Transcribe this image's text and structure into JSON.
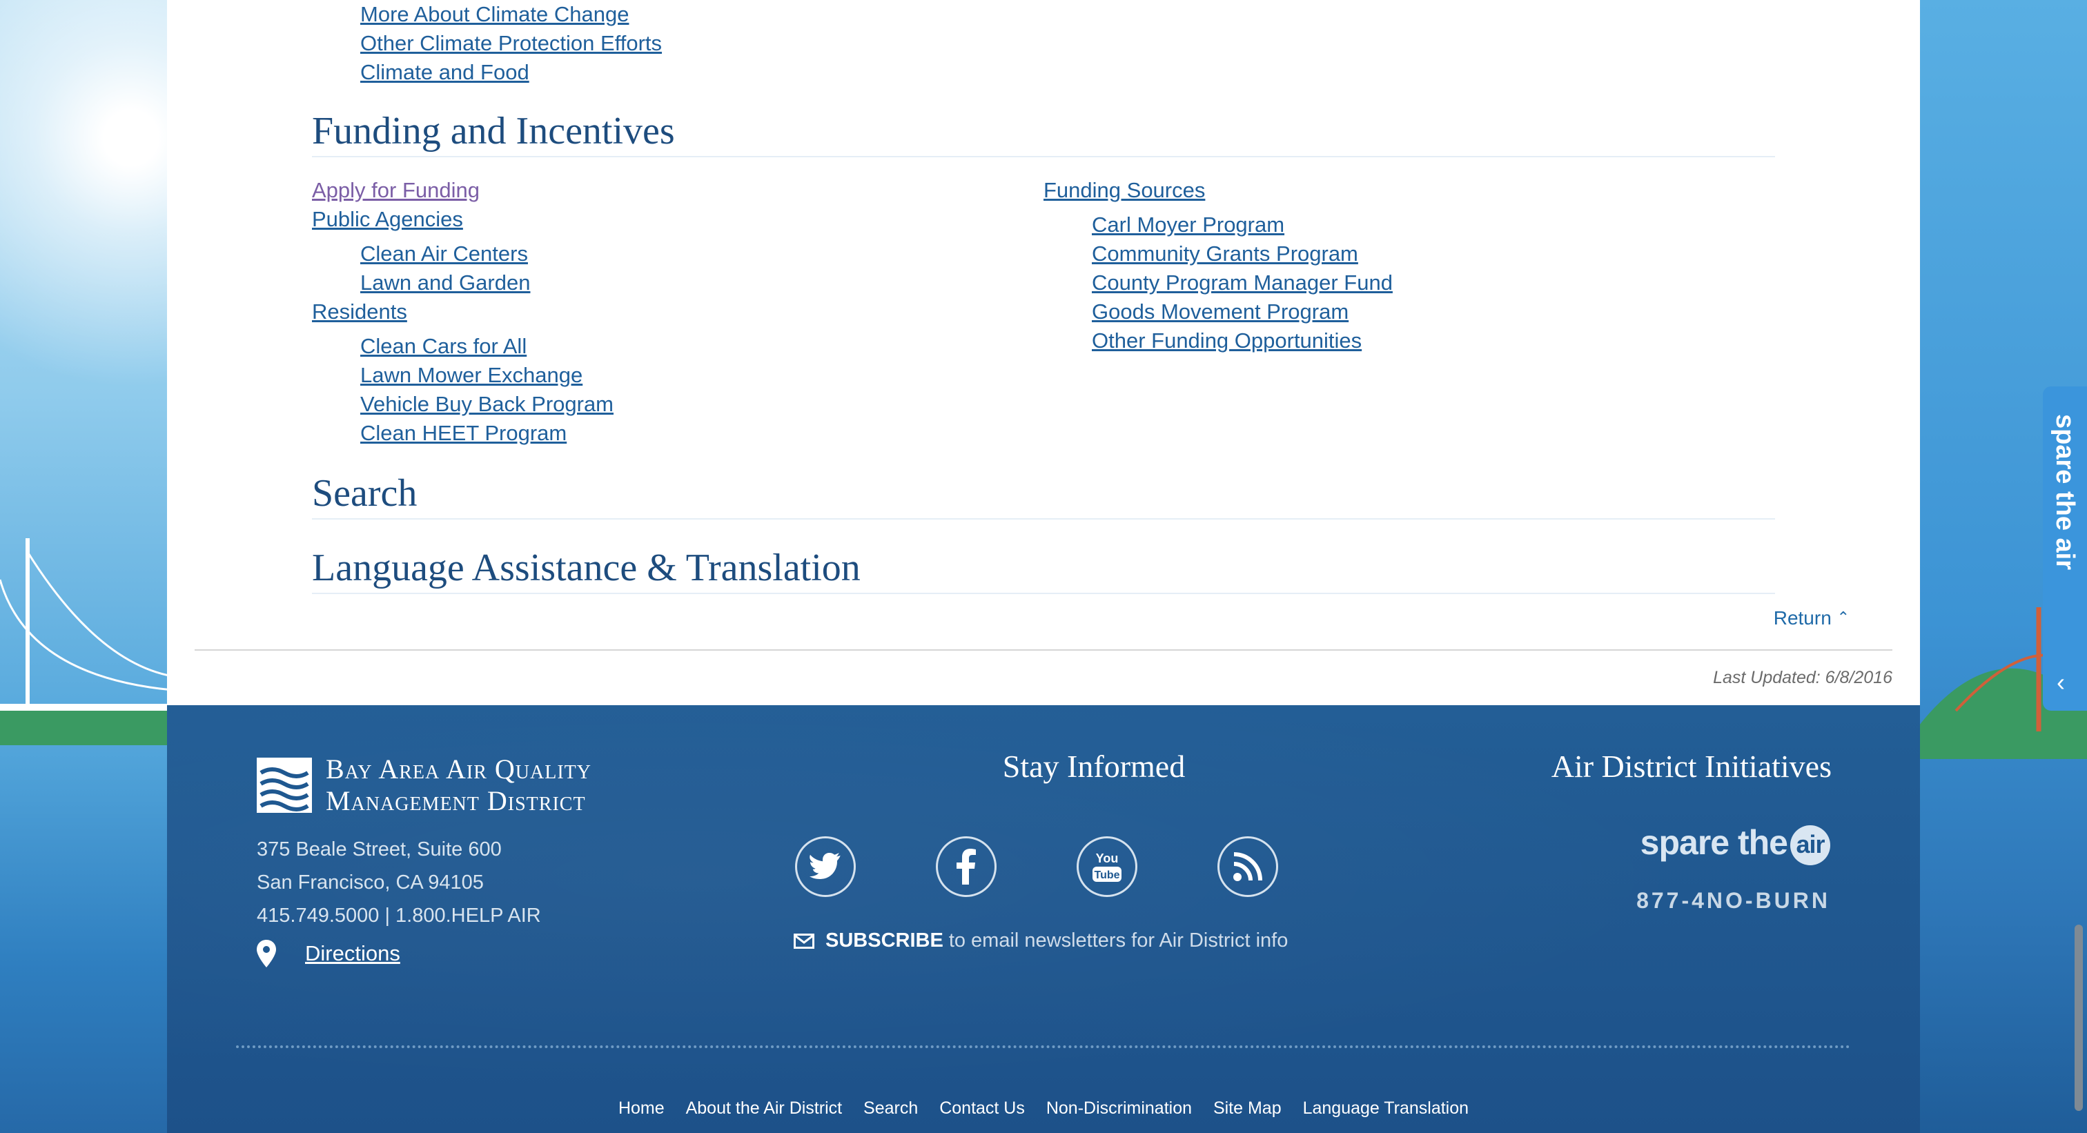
{
  "top_links": [
    "More About Climate Change",
    "Other Climate Protection Efforts",
    "Climate and Food"
  ],
  "funding": {
    "heading": "Funding and Incentives",
    "left": {
      "apply": "Apply for Funding",
      "public": "Public Agencies",
      "public_items": [
        "Clean Air Centers",
        "Lawn and Garden"
      ],
      "residents": "Residents",
      "resident_items": [
        "Clean Cars for All",
        "Lawn Mower Exchange",
        "Vehicle Buy Back Program",
        "Clean HEET Program"
      ]
    },
    "right": {
      "sources": "Funding Sources",
      "source_items": [
        "Carl Moyer Program",
        "Community Grants Program",
        "County Program Manager Fund",
        "Goods Movement Program",
        "Other Funding Opportunities"
      ]
    }
  },
  "search_heading": "Search",
  "language_heading": "Language Assistance & Translation",
  "return_label": "Return",
  "last_updated": "Last Updated: 6/8/2016",
  "footer": {
    "logo_line1": "Bay Area Air Quality",
    "logo_line2": "Management District",
    "address": [
      "375 Beale Street, Suite 600",
      "San Francisco, CA 94105",
      "415.749.5000 | 1.800.HELP AIR"
    ],
    "directions": "Directions",
    "stay_title": "Stay Informed",
    "subscribe_bold": "SUBSCRIBE",
    "subscribe_rest": "to email newsletters for Air District info",
    "initiatives_title": "Air District Initiatives",
    "spare_the": "spare the",
    "spare_air": "air",
    "burn_line": "877-4NO-BURN",
    "nav": [
      "Home",
      "About the Air District",
      "Search",
      "Contact Us",
      "Non-Discrimination",
      "Site Map",
      "Language Translation"
    ]
  },
  "side_tab_label": "spare the air",
  "icons": [
    "twitter-icon",
    "facebook-icon",
    "youtube-icon",
    "rss-icon",
    "envelope-icon",
    "map-pin-icon",
    "chevron-up-icon",
    "chevron-left-icon"
  ],
  "colors": {
    "link": "#1f5f9b",
    "heading": "#1d4c7e",
    "footer": "#1f5890"
  }
}
